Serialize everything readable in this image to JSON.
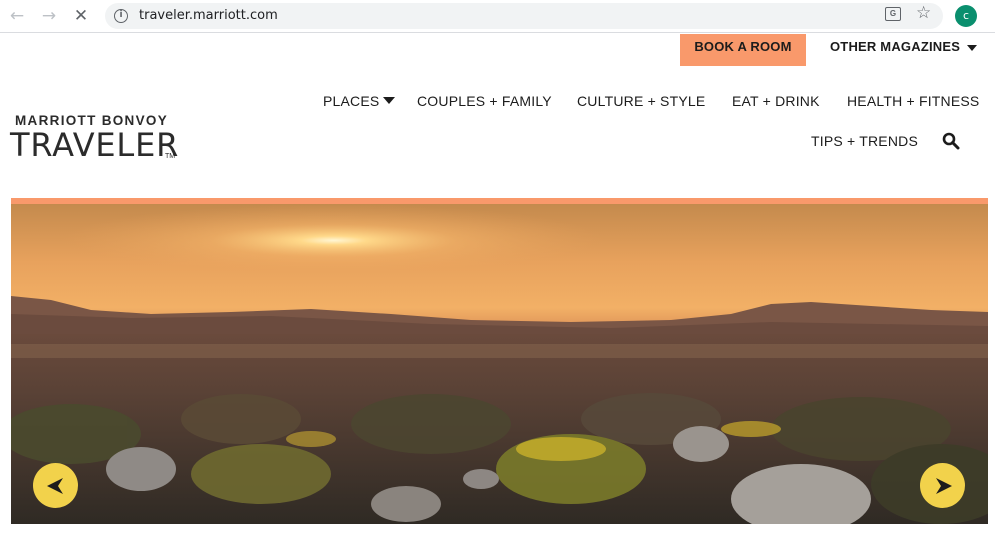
{
  "browser": {
    "url": "traveler.marriott.com",
    "profile_initial": "c",
    "icons": [
      "back-icon",
      "forward-icon",
      "stop-loading-icon",
      "info-icon",
      "translate-icon",
      "star-icon"
    ]
  },
  "utility": {
    "book_label": "BOOK A ROOM",
    "other_mags_label": "OTHER MAGAZINES"
  },
  "logo": {
    "top_line": "MARRIOTT BONVOY",
    "main_line": "TRAVELER",
    "tm": "TM"
  },
  "nav": {
    "items": [
      {
        "label": "PLACES",
        "has_dropdown": true
      },
      {
        "label": "COUPLES + FAMILY"
      },
      {
        "label": "CULTURE + STYLE"
      },
      {
        "label": "EAT + DRINK"
      },
      {
        "label": "HEALTH + FITNESS"
      },
      {
        "label": "TIPS + TRENDS"
      }
    ]
  },
  "hero": {
    "description_icon": "desert-sunset-photo",
    "prev_icon": "arrow-left-icon",
    "next_icon": "arrow-right-icon"
  },
  "colors": {
    "accent": "#f9996b",
    "carousel_button": "#f2d24b",
    "text": "#1c1c1c"
  }
}
